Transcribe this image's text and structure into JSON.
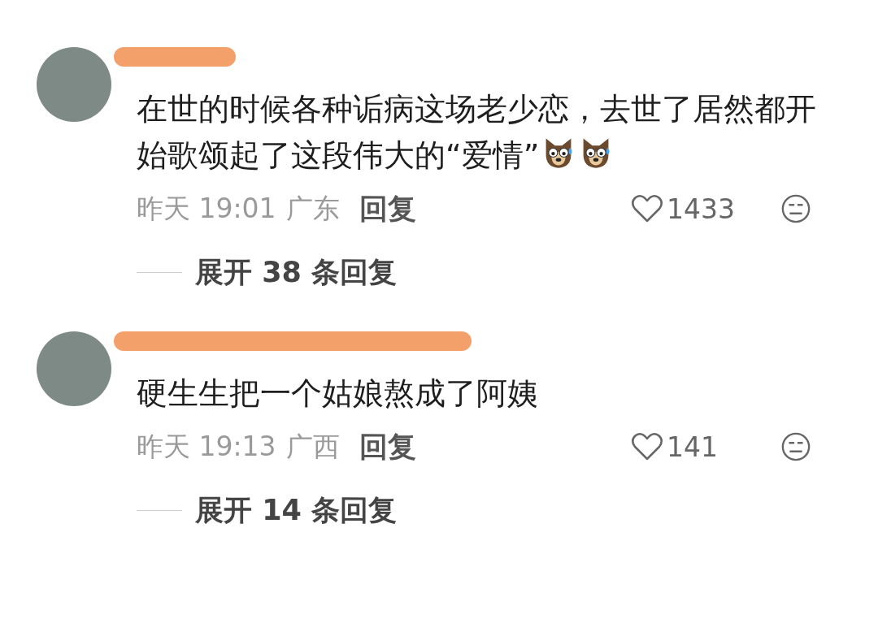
{
  "comments": [
    {
      "text": "在世的时候各种诟病这场老少恋，去世了居然都开始歌颂起了这段伟大的“爱情”",
      "emoji": true,
      "time": "昨天 19:01",
      "location": "广东",
      "reply": "回复",
      "likes": "1433",
      "expand": "展开 38 条回复"
    },
    {
      "text": "硬生生把一个姑娘熬成了阿姨",
      "emoji": false,
      "time": "昨天 19:13",
      "location": "广西",
      "reply": "回复",
      "likes": "141",
      "expand": "展开 14 条回复"
    }
  ]
}
